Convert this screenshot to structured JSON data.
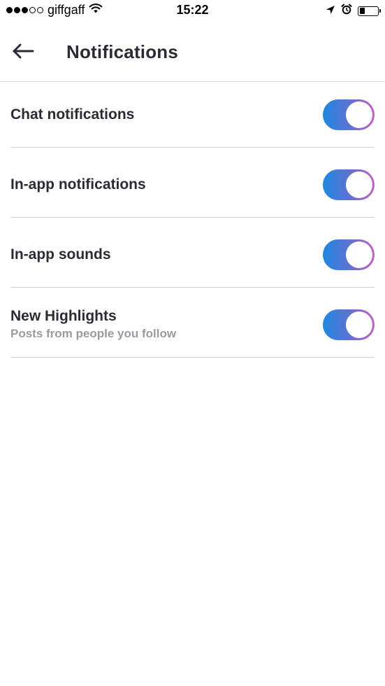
{
  "status_bar": {
    "signal_filled": 3,
    "signal_total": 5,
    "carrier": "giffgaff",
    "time": "15:22",
    "battery_level": 0.3,
    "icons": [
      "wifi-icon",
      "location-arrow-icon",
      "alarm-icon",
      "battery-icon"
    ]
  },
  "header": {
    "back_icon": "arrow-left-icon",
    "title": "Notifications"
  },
  "settings": [
    {
      "label": "Chat notifications",
      "sublabel": "",
      "enabled": true
    },
    {
      "label": "In-app notifications",
      "sublabel": "",
      "enabled": true
    },
    {
      "label": "In-app sounds",
      "sublabel": "",
      "enabled": true
    },
    {
      "label": "New Highlights",
      "sublabel": "Posts from people you follow",
      "enabled": true
    }
  ],
  "colors": {
    "toggle_gradient_start": "#1e88e0",
    "toggle_gradient_end": "#c660c4",
    "text_primary": "#2b2b33",
    "text_secondary": "#9a9aa2",
    "divider": "#d9d9dc"
  }
}
